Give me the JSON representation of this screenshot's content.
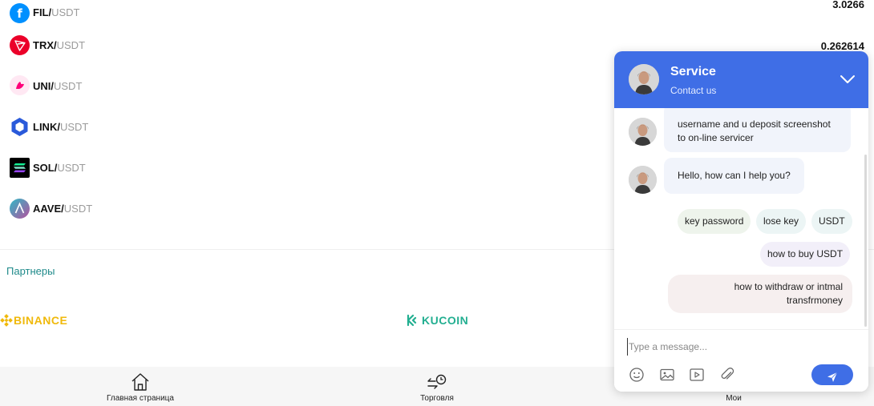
{
  "coins": [
    {
      "base": "FIL/",
      "quote": "USDT",
      "price": "3.0266",
      "icon": "filecoin-icon",
      "color": "#0090ff"
    },
    {
      "base": "TRX/",
      "quote": "USDT",
      "price": "0.262614",
      "icon": "tron-icon",
      "color": "#eb0029"
    },
    {
      "base": "UNI/",
      "quote": "USDT",
      "price": "",
      "icon": "uniswap-icon",
      "color": "#ff007a"
    },
    {
      "base": "LINK/",
      "quote": "USDT",
      "price": "",
      "icon": "chainlink-icon",
      "color": "#2a5ada"
    },
    {
      "base": "SOL/",
      "quote": "USDT",
      "price": "",
      "icon": "solana-icon",
      "color": "#000000"
    },
    {
      "base": "AAVE/",
      "quote": "USDT",
      "price": "",
      "icon": "aave-icon",
      "color": "#b6509e"
    }
  ],
  "partners": {
    "title": "Партнеры",
    "items": [
      {
        "name": "BINANCE",
        "icon": "binance-logo",
        "color": "#f0b90b"
      },
      {
        "name": "KUCOIN",
        "icon": "kucoin-logo",
        "color": "#23af91"
      }
    ]
  },
  "nav": {
    "home": {
      "label": "Главная страница",
      "icon": "home-icon"
    },
    "trade": {
      "label": "Торговля",
      "icon": "trade-clock-icon"
    },
    "mine": {
      "label": "Мои",
      "icon": "user-icon"
    }
  },
  "chat": {
    "title": "Service",
    "subtitle": "Contact us",
    "accent": "#3f6ee6",
    "messages": [
      {
        "line1": "username and u deposit screenshot",
        "line2": "to on-line servicer"
      },
      {
        "line1": "Hello, how can I help you?"
      }
    ],
    "quick_replies": [
      "key password",
      "lose key",
      "USDT",
      "how to buy USDT"
    ],
    "quick_reply_multi": {
      "line1": "how to withdraw or intmal",
      "line2": "transfrmoney"
    },
    "input_placeholder": "Type a message...",
    "tools": [
      "emoji-icon",
      "image-icon",
      "video-icon",
      "attachment-icon"
    ],
    "send_icon": "send-icon"
  }
}
